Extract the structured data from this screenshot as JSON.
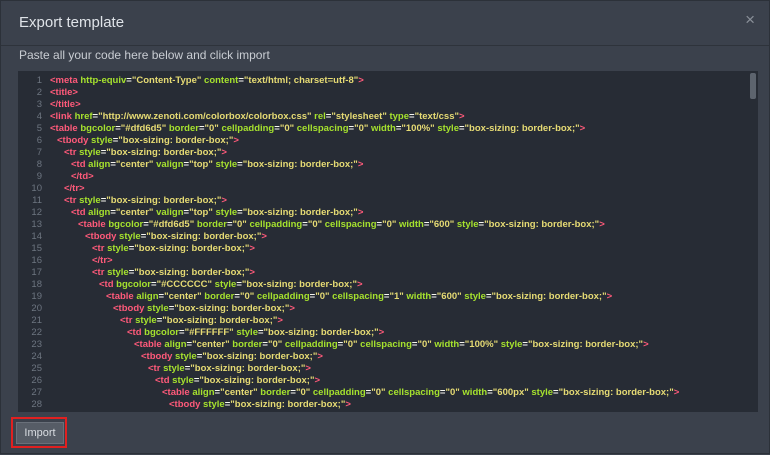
{
  "dialog": {
    "title": "Export template",
    "close_symbol": "×",
    "instruction": "Paste all your code here below and click import",
    "import_label": "Import"
  },
  "code_lines": [
    {
      "n": "1",
      "indent": 0,
      "tokens": [
        [
          "<meta ",
          "tag"
        ],
        [
          "http-equiv",
          "attr"
        ],
        [
          "=",
          "p"
        ],
        [
          "\"Content-Type\"",
          "str"
        ],
        [
          " ",
          "p"
        ],
        [
          "content",
          "attr"
        ],
        [
          "=",
          "p"
        ],
        [
          "\"text/html; charset=utf-8\"",
          "str"
        ],
        [
          ">",
          "tag"
        ]
      ]
    },
    {
      "n": "2",
      "indent": 0,
      "tokens": [
        [
          "<title>",
          "tag"
        ]
      ]
    },
    {
      "n": "3",
      "indent": 0,
      "tokens": [
        [
          "</title>",
          "tag"
        ]
      ]
    },
    {
      "n": "4",
      "indent": 0,
      "tokens": [
        [
          "<link ",
          "tag"
        ],
        [
          "href",
          "attr"
        ],
        [
          "=",
          "p"
        ],
        [
          "\"http://www.zenoti.com/colorbox/colorbox.css\"",
          "str"
        ],
        [
          " ",
          "p"
        ],
        [
          "rel",
          "attr"
        ],
        [
          "=",
          "p"
        ],
        [
          "\"stylesheet\"",
          "str"
        ],
        [
          " ",
          "p"
        ],
        [
          "type",
          "attr"
        ],
        [
          "=",
          "p"
        ],
        [
          "\"text/css\"",
          "str"
        ],
        [
          ">",
          "tag"
        ]
      ]
    },
    {
      "n": "5",
      "indent": 0,
      "tokens": [
        [
          "<table ",
          "tag"
        ],
        [
          "bgcolor",
          "attr"
        ],
        [
          "=",
          "p"
        ],
        [
          "\"#dfd6d5\"",
          "str"
        ],
        [
          " ",
          "p"
        ],
        [
          "border",
          "attr"
        ],
        [
          "=",
          "p"
        ],
        [
          "\"0\"",
          "str"
        ],
        [
          " ",
          "p"
        ],
        [
          "cellpadding",
          "attr"
        ],
        [
          "=",
          "p"
        ],
        [
          "\"0\"",
          "str"
        ],
        [
          " ",
          "p"
        ],
        [
          "cellspacing",
          "attr"
        ],
        [
          "=",
          "p"
        ],
        [
          "\"0\"",
          "str"
        ],
        [
          " ",
          "p"
        ],
        [
          "width",
          "attr"
        ],
        [
          "=",
          "p"
        ],
        [
          "\"100%\"",
          "str"
        ],
        [
          " ",
          "p"
        ],
        [
          "style",
          "attr"
        ],
        [
          "=",
          "p"
        ],
        [
          "\"box-sizing: border-box;\"",
          "str"
        ],
        [
          ">",
          "tag"
        ]
      ]
    },
    {
      "n": "6",
      "indent": 1,
      "tokens": [
        [
          "<tbody ",
          "tag"
        ],
        [
          "style",
          "attr"
        ],
        [
          "=",
          "p"
        ],
        [
          "\"box-sizing: border-box;\"",
          "str"
        ],
        [
          ">",
          "tag"
        ]
      ]
    },
    {
      "n": "7",
      "indent": 2,
      "tokens": [
        [
          "<tr ",
          "tag"
        ],
        [
          "style",
          "attr"
        ],
        [
          "=",
          "p"
        ],
        [
          "\"box-sizing: border-box;\"",
          "str"
        ],
        [
          ">",
          "tag"
        ]
      ]
    },
    {
      "n": "8",
      "indent": 3,
      "tokens": [
        [
          "<td ",
          "tag"
        ],
        [
          "align",
          "attr"
        ],
        [
          "=",
          "p"
        ],
        [
          "\"center\"",
          "str"
        ],
        [
          " ",
          "p"
        ],
        [
          "valign",
          "attr"
        ],
        [
          "=",
          "p"
        ],
        [
          "\"top\"",
          "str"
        ],
        [
          " ",
          "p"
        ],
        [
          "style",
          "attr"
        ],
        [
          "=",
          "p"
        ],
        [
          "\"box-sizing: border-box;\"",
          "str"
        ],
        [
          ">",
          "tag"
        ]
      ]
    },
    {
      "n": "9",
      "indent": 3,
      "tokens": [
        [
          "</td>",
          "tag"
        ]
      ]
    },
    {
      "n": "10",
      "indent": 2,
      "tokens": [
        [
          "</tr>",
          "tag"
        ]
      ]
    },
    {
      "n": "11",
      "indent": 2,
      "tokens": [
        [
          "<tr ",
          "tag"
        ],
        [
          "style",
          "attr"
        ],
        [
          "=",
          "p"
        ],
        [
          "\"box-sizing: border-box;\"",
          "str"
        ],
        [
          ">",
          "tag"
        ]
      ]
    },
    {
      "n": "12",
      "indent": 3,
      "tokens": [
        [
          "<td ",
          "tag"
        ],
        [
          "align",
          "attr"
        ],
        [
          "=",
          "p"
        ],
        [
          "\"center\"",
          "str"
        ],
        [
          " ",
          "p"
        ],
        [
          "valign",
          "attr"
        ],
        [
          "=",
          "p"
        ],
        [
          "\"top\"",
          "str"
        ],
        [
          " ",
          "p"
        ],
        [
          "style",
          "attr"
        ],
        [
          "=",
          "p"
        ],
        [
          "\"box-sizing: border-box;\"",
          "str"
        ],
        [
          ">",
          "tag"
        ]
      ]
    },
    {
      "n": "13",
      "indent": 4,
      "tokens": [
        [
          "<table ",
          "tag"
        ],
        [
          "bgcolor",
          "attr"
        ],
        [
          "=",
          "p"
        ],
        [
          "\"#dfd6d5\"",
          "str"
        ],
        [
          " ",
          "p"
        ],
        [
          "border",
          "attr"
        ],
        [
          "=",
          "p"
        ],
        [
          "\"0\"",
          "str"
        ],
        [
          " ",
          "p"
        ],
        [
          "cellpadding",
          "attr"
        ],
        [
          "=",
          "p"
        ],
        [
          "\"0\"",
          "str"
        ],
        [
          " ",
          "p"
        ],
        [
          "cellspacing",
          "attr"
        ],
        [
          "=",
          "p"
        ],
        [
          "\"0\"",
          "str"
        ],
        [
          " ",
          "p"
        ],
        [
          "width",
          "attr"
        ],
        [
          "=",
          "p"
        ],
        [
          "\"600\"",
          "str"
        ],
        [
          " ",
          "p"
        ],
        [
          "style",
          "attr"
        ],
        [
          "=",
          "p"
        ],
        [
          "\"box-sizing: border-box;\"",
          "str"
        ],
        [
          ">",
          "tag"
        ]
      ]
    },
    {
      "n": "14",
      "indent": 5,
      "tokens": [
        [
          "<tbody ",
          "tag"
        ],
        [
          "style",
          "attr"
        ],
        [
          "=",
          "p"
        ],
        [
          "\"box-sizing: border-box;\"",
          "str"
        ],
        [
          ">",
          "tag"
        ]
      ]
    },
    {
      "n": "15",
      "indent": 6,
      "tokens": [
        [
          "<tr ",
          "tag"
        ],
        [
          "style",
          "attr"
        ],
        [
          "=",
          "p"
        ],
        [
          "\"box-sizing: border-box;\"",
          "str"
        ],
        [
          ">",
          "tag"
        ]
      ]
    },
    {
      "n": "16",
      "indent": 6,
      "tokens": [
        [
          "</tr>",
          "tag"
        ]
      ]
    },
    {
      "n": "17",
      "indent": 6,
      "tokens": [
        [
          "<tr ",
          "tag"
        ],
        [
          "style",
          "attr"
        ],
        [
          "=",
          "p"
        ],
        [
          "\"box-sizing: border-box;\"",
          "str"
        ],
        [
          ">",
          "tag"
        ]
      ]
    },
    {
      "n": "18",
      "indent": 7,
      "tokens": [
        [
          "<td ",
          "tag"
        ],
        [
          "bgcolor",
          "attr"
        ],
        [
          "=",
          "p"
        ],
        [
          "\"#CCCCCC\"",
          "str"
        ],
        [
          " ",
          "p"
        ],
        [
          "style",
          "attr"
        ],
        [
          "=",
          "p"
        ],
        [
          "\"box-sizing: border-box;\"",
          "str"
        ],
        [
          ">",
          "tag"
        ]
      ]
    },
    {
      "n": "19",
      "indent": 8,
      "tokens": [
        [
          "<table ",
          "tag"
        ],
        [
          "align",
          "attr"
        ],
        [
          "=",
          "p"
        ],
        [
          "\"center\"",
          "str"
        ],
        [
          " ",
          "p"
        ],
        [
          "border",
          "attr"
        ],
        [
          "=",
          "p"
        ],
        [
          "\"0\"",
          "str"
        ],
        [
          " ",
          "p"
        ],
        [
          "cellpadding",
          "attr"
        ],
        [
          "=",
          "p"
        ],
        [
          "\"0\"",
          "str"
        ],
        [
          " ",
          "p"
        ],
        [
          "cellspacing",
          "attr"
        ],
        [
          "=",
          "p"
        ],
        [
          "\"1\"",
          "str"
        ],
        [
          " ",
          "p"
        ],
        [
          "width",
          "attr"
        ],
        [
          "=",
          "p"
        ],
        [
          "\"600\"",
          "str"
        ],
        [
          " ",
          "p"
        ],
        [
          "style",
          "attr"
        ],
        [
          "=",
          "p"
        ],
        [
          "\"box-sizing: border-box;\"",
          "str"
        ],
        [
          ">",
          "tag"
        ]
      ]
    },
    {
      "n": "20",
      "indent": 9,
      "tokens": [
        [
          "<tbody ",
          "tag"
        ],
        [
          "style",
          "attr"
        ],
        [
          "=",
          "p"
        ],
        [
          "\"box-sizing: border-box;\"",
          "str"
        ],
        [
          ">",
          "tag"
        ]
      ]
    },
    {
      "n": "21",
      "indent": 10,
      "tokens": [
        [
          "<tr ",
          "tag"
        ],
        [
          "style",
          "attr"
        ],
        [
          "=",
          "p"
        ],
        [
          "\"box-sizing: border-box;\"",
          "str"
        ],
        [
          ">",
          "tag"
        ]
      ]
    },
    {
      "n": "22",
      "indent": 11,
      "tokens": [
        [
          "<td ",
          "tag"
        ],
        [
          "bgcolor",
          "attr"
        ],
        [
          "=",
          "p"
        ],
        [
          "\"#FFFFFF\"",
          "str"
        ],
        [
          " ",
          "p"
        ],
        [
          "style",
          "attr"
        ],
        [
          "=",
          "p"
        ],
        [
          "\"box-sizing: border-box;\"",
          "str"
        ],
        [
          ">",
          "tag"
        ]
      ]
    },
    {
      "n": "23",
      "indent": 12,
      "tokens": [
        [
          "<table ",
          "tag"
        ],
        [
          "align",
          "attr"
        ],
        [
          "=",
          "p"
        ],
        [
          "\"center\"",
          "str"
        ],
        [
          " ",
          "p"
        ],
        [
          "border",
          "attr"
        ],
        [
          "=",
          "p"
        ],
        [
          "\"0\"",
          "str"
        ],
        [
          " ",
          "p"
        ],
        [
          "cellpadding",
          "attr"
        ],
        [
          "=",
          "p"
        ],
        [
          "\"0\"",
          "str"
        ],
        [
          " ",
          "p"
        ],
        [
          "cellspacing",
          "attr"
        ],
        [
          "=",
          "p"
        ],
        [
          "\"0\"",
          "str"
        ],
        [
          " ",
          "p"
        ],
        [
          "width",
          "attr"
        ],
        [
          "=",
          "p"
        ],
        [
          "\"100%\"",
          "str"
        ],
        [
          " ",
          "p"
        ],
        [
          "style",
          "attr"
        ],
        [
          "=",
          "p"
        ],
        [
          "\"box-sizing: border-box;\"",
          "str"
        ],
        [
          ">",
          "tag"
        ]
      ]
    },
    {
      "n": "24",
      "indent": 13,
      "tokens": [
        [
          "<tbody ",
          "tag"
        ],
        [
          "style",
          "attr"
        ],
        [
          "=",
          "p"
        ],
        [
          "\"box-sizing: border-box;\"",
          "str"
        ],
        [
          ">",
          "tag"
        ]
      ]
    },
    {
      "n": "25",
      "indent": 14,
      "tokens": [
        [
          "<tr ",
          "tag"
        ],
        [
          "style",
          "attr"
        ],
        [
          "=",
          "p"
        ],
        [
          "\"box-sizing: border-box;\"",
          "str"
        ],
        [
          ">",
          "tag"
        ]
      ]
    },
    {
      "n": "26",
      "indent": 15,
      "tokens": [
        [
          "<td ",
          "tag"
        ],
        [
          "style",
          "attr"
        ],
        [
          "=",
          "p"
        ],
        [
          "\"box-sizing: border-box;\"",
          "str"
        ],
        [
          ">",
          "tag"
        ]
      ]
    },
    {
      "n": "27",
      "indent": 16,
      "tokens": [
        [
          "<table ",
          "tag"
        ],
        [
          "align",
          "attr"
        ],
        [
          "=",
          "p"
        ],
        [
          "\"center\"",
          "str"
        ],
        [
          " ",
          "p"
        ],
        [
          "border",
          "attr"
        ],
        [
          "=",
          "p"
        ],
        [
          "\"0\"",
          "str"
        ],
        [
          " ",
          "p"
        ],
        [
          "cellpadding",
          "attr"
        ],
        [
          "=",
          "p"
        ],
        [
          "\"0\"",
          "str"
        ],
        [
          " ",
          "p"
        ],
        [
          "cellspacing",
          "attr"
        ],
        [
          "=",
          "p"
        ],
        [
          "\"0\"",
          "str"
        ],
        [
          " ",
          "p"
        ],
        [
          "width",
          "attr"
        ],
        [
          "=",
          "p"
        ],
        [
          "\"600px\"",
          "str"
        ],
        [
          " ",
          "p"
        ],
        [
          "style",
          "attr"
        ],
        [
          "=",
          "p"
        ],
        [
          "\"box-sizing: border-box;\"",
          "str"
        ],
        [
          ">",
          "tag"
        ]
      ]
    },
    {
      "n": "28",
      "indent": 17,
      "tokens": [
        [
          "<tbody ",
          "tag"
        ],
        [
          "style",
          "attr"
        ],
        [
          "=",
          "p"
        ],
        [
          "\"box-sizing: border-box;\"",
          "str"
        ],
        [
          ">",
          "tag"
        ]
      ]
    }
  ]
}
